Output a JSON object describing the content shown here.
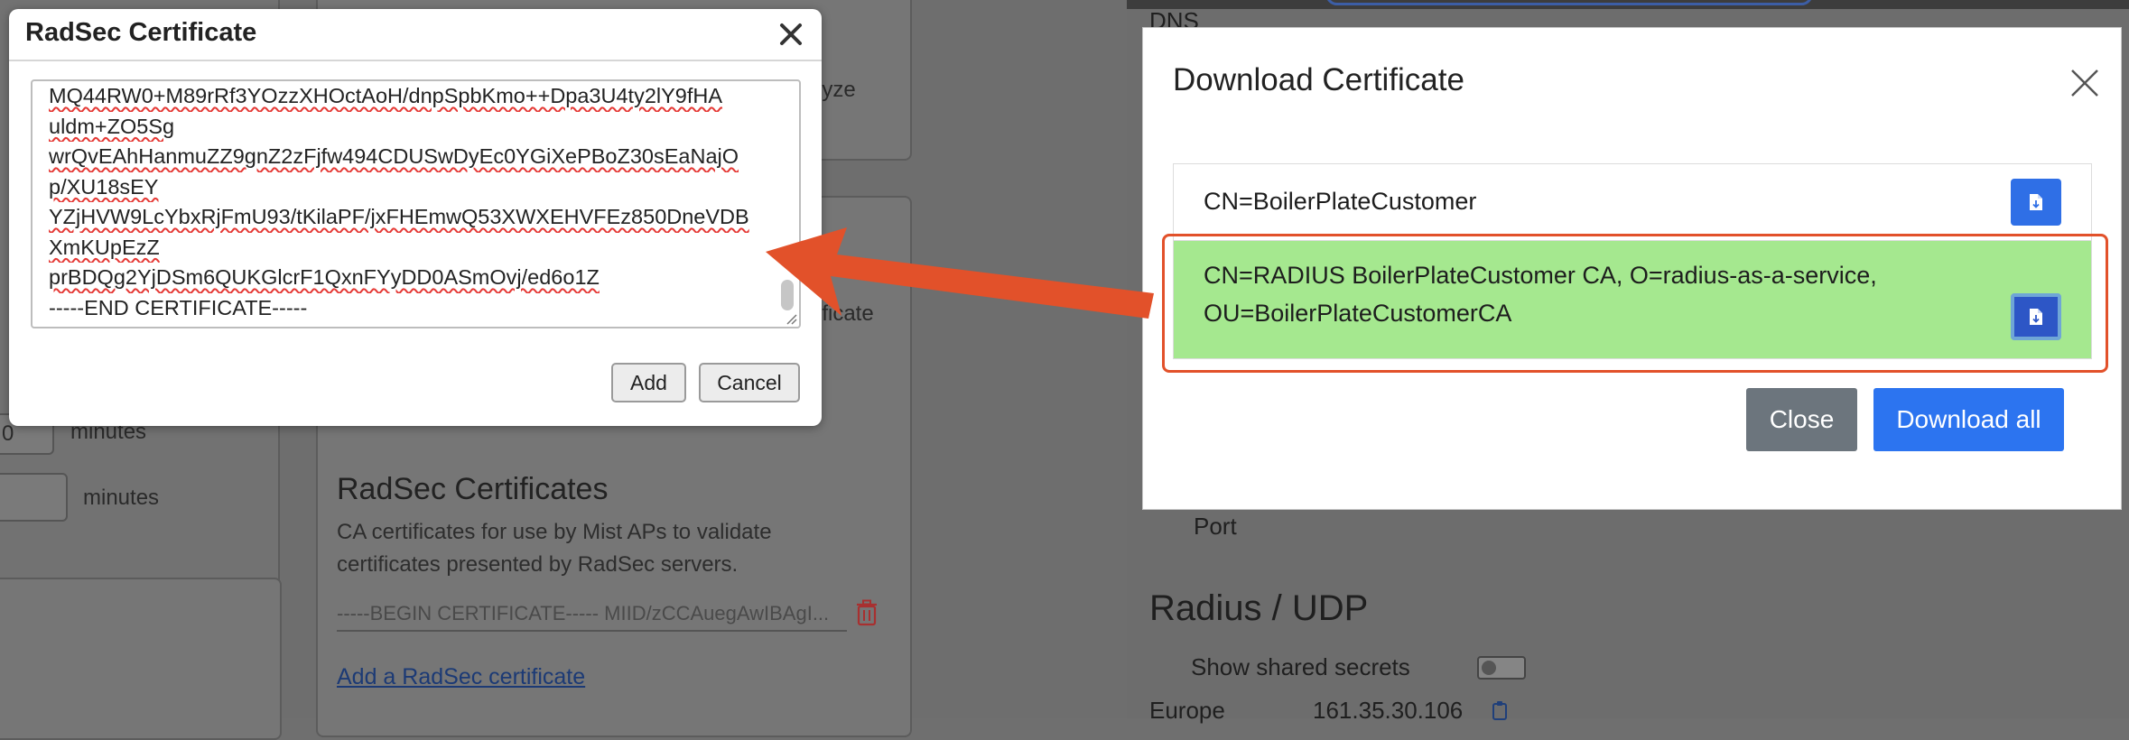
{
  "left_app": {
    "analyze_fragment": "lyze",
    "certificate_fragment": "ificate",
    "number_fragment": "0",
    "minutes_label_1": "minutes",
    "minutes_label_2": "minutes",
    "radsec_title": "RadSec Certificates",
    "radsec_description": "CA certificates for use by Mist APs to validate certificates presented by RadSec servers.",
    "cert_entry": "-----BEGIN CERTIFICATE----- MIID/zCCAuegAwIBAgI...",
    "add_link": "Add a RadSec certificate"
  },
  "radsec_dialog": {
    "title": "RadSec Certificate",
    "cert_lines": [
      "MQ44RW0+M89rRf3YOzzXHOctAoH/dnpSpbKmo++Dpa3U4ty2lY9fHA",
      "uldm+ZO5Sg",
      "wrQvEAhHanmuZZ9gnZ2zFjfw494CDUSwDyEc0YGiXePBoZ30sEaNajO",
      "p/XU18sEY",
      "YZjHVW9LcYbxRjFmU93/tKilaPF/jxFHEmwQ53XWXEHVFEz850DneVDB",
      "XmKUpEzZ",
      "prBDQg2YjDSm6QUKGlcrF1QxnFYyDD0ASmOvj/ed6o1Z",
      "-----END CERTIFICATE-----"
    ],
    "add_label": "Add",
    "cancel_label": "Cancel"
  },
  "right_app": {
    "dns_label": "DNS",
    "port_label": "Port",
    "radius_title": "Radius / UDP",
    "show_secrets_label": "Show shared secrets",
    "show_secrets_on": false,
    "region_label": "Europe",
    "ip_value": "161.35.30.106"
  },
  "download_dialog": {
    "title": "Download Certificate",
    "certificates": [
      {
        "label": "CN=BoilerPlateCustomer"
      },
      {
        "label": "CN=RADIUS BoilerPlateCustomer CA, O=radius-as-a-service, OU=BoilerPlateCustomerCA"
      }
    ],
    "close_label": "Close",
    "download_all_label": "Download all"
  },
  "colors": {
    "accent_blue": "#2c74f0",
    "highlight_green": "#a5e88f",
    "annotation_red": "#e2512a",
    "secondary_gray": "#6c757d"
  },
  "icons": {
    "dialog_close": "close-icon",
    "row_download": "file-download-icon",
    "delete": "trash-icon",
    "copy": "clipboard-icon"
  }
}
